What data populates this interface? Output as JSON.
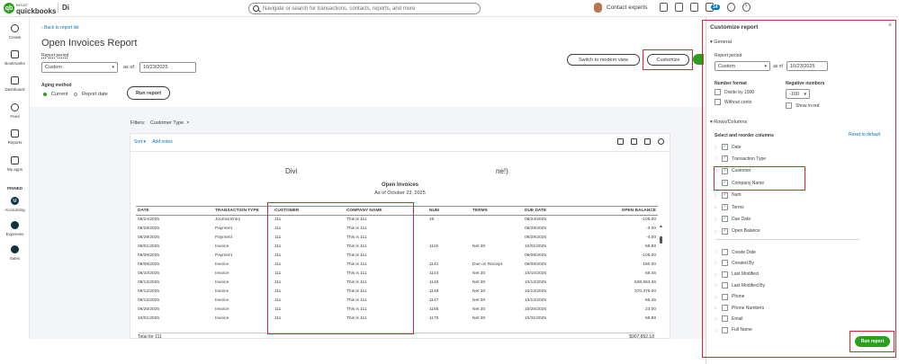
{
  "brand": {
    "intuit": "INTUIT",
    "product": "quickbooks",
    "logo_initials": "qb"
  },
  "company": {
    "name": "Di"
  },
  "search": {
    "placeholder": "Navigate or search for transactions, contacts, reports, and more"
  },
  "header": {
    "contact_label": "Contact experts",
    "notification_count": "14"
  },
  "nav": {
    "items": [
      "Create",
      "Bookmarks",
      "Dashboard",
      "Feed",
      "Reports",
      "My apps"
    ],
    "section_label": "PINNED",
    "pinned": [
      {
        "label": "Accounting",
        "initial": "M"
      },
      {
        "label": "Expenses",
        "initial": ""
      },
      {
        "label": "Sales",
        "initial": ""
      }
    ]
  },
  "report_header": {
    "back_link": "Back to report list",
    "title": "Open Invoices Report",
    "period_label": "Report period",
    "period_value": "Custom",
    "as_of_label": "as of",
    "as_of_value": "10/23/2025",
    "aging_label": "Aging method",
    "aging_current": "Current",
    "aging_report_date": "Report date",
    "run_report_label": "Run report",
    "switch_label": "Switch to modern view",
    "customize_label": "Customize"
  },
  "filters": {
    "label": "Filters:",
    "chip": "Customer Type"
  },
  "report": {
    "toolbar": {
      "sort": "Sort ▾",
      "add_notes": "Add notes"
    },
    "company_part_a": "Divi",
    "company_part_b": "ne!)",
    "title": "Open Invoices",
    "subtitle": "As of October 23, 2025",
    "columns": [
      "DATE",
      "TRANSACTION TYPE",
      "CUSTOMER",
      "COMPANY NAME",
      "NUM",
      "TERMS",
      "DUE DATE",
      "OPEN BALANCE"
    ],
    "rows": [
      [
        "08/24/2025",
        "Journal Entry",
        "111",
        "This is 111",
        "45",
        "",
        "08/24/2025",
        "-105.00"
      ],
      [
        "08/29/2025",
        "Payment",
        "111",
        "This is 111",
        "",
        "",
        "08/29/2025",
        "-3.00"
      ],
      [
        "08/29/2025",
        "Payment",
        "111",
        "This is 111",
        "",
        "",
        "08/29/2025",
        "-4.00"
      ],
      [
        "09/01/2025",
        "Invoice",
        "111",
        "This is 111",
        "1119",
        "Net 30",
        "10/01/2025",
        "58.99"
      ],
      [
        "09/09/2025",
        "Payment",
        "111",
        "This is 111",
        "",
        "",
        "09/09/2025",
        "-105.00"
      ],
      [
        "09/09/2025",
        "Invoice",
        "111",
        "This is 111",
        "1141",
        "Due on Receipt",
        "09/09/2025",
        "150.00"
      ],
      [
        "09/10/2025",
        "Invoice",
        "111",
        "This is 111",
        "1144",
        "Net 30",
        "10/10/2025",
        "66.45"
      ],
      [
        "09/12/2025",
        "Invoice",
        "111",
        "This is 111",
        "1149",
        "Net 30",
        "10/12/2025",
        "538,994.36"
      ],
      [
        "09/12/2025",
        "Invoice",
        "111",
        "This is 111",
        "1148",
        "Net 30",
        "10/12/2025",
        "370,378.00"
      ],
      [
        "09/12/2025",
        "Invoice",
        "111",
        "This is 111",
        "1147",
        "Net 30",
        "10/12/2025",
        "66.45"
      ],
      [
        "09/26/2025",
        "Invoice",
        "111",
        "This is 111",
        "1165",
        "Net 30",
        "10/26/2025",
        "23.00"
      ],
      [
        "10/01/2025",
        "Invoice",
        "111",
        "This is 111",
        "1175",
        "Net 30",
        "10/31/2025",
        "58.99"
      ]
    ],
    "total_label": "Total for 111",
    "total_value": "$907,852.18"
  },
  "panel": {
    "title": "Customize report",
    "general_label": "▾ General",
    "period_label": "Report period",
    "period_value": "Custom",
    "as_of_label": "as of",
    "as_of_value": "10/23/2025",
    "number_format_label": "Number format",
    "divide_by_1000": "Divide by 1000",
    "without_cents": "Without cents",
    "negative_numbers_label": "Negative numbers",
    "negative_value": "-100",
    "show_in_red": "Show in red",
    "rows_columns_label": "▾ Rows/Columns",
    "select_reorder_label": "Select and reorder columns",
    "reset_label": "Reset to default",
    "checked_columns": [
      "Date",
      "Transaction Type",
      "Customer",
      "Company Name",
      "Num",
      "Terms",
      "Due Date",
      "Open Balance"
    ],
    "unchecked_columns": [
      "Create Date",
      "Created By",
      "Last Modified",
      "Last Modified By",
      "Phone",
      "Phone Numbers",
      "Email",
      "Full Name"
    ],
    "run_report_label": "Run report"
  },
  "colors": {
    "accent_green": "#2ca01c",
    "link_blue": "#0077c5",
    "highlight_red": "#e0262b"
  }
}
